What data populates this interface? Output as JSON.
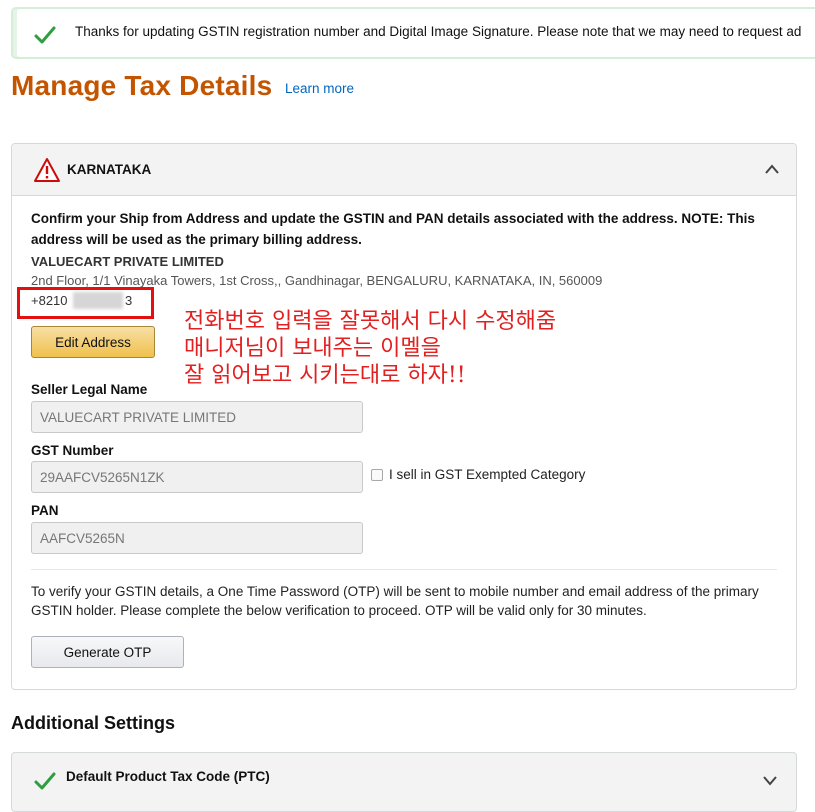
{
  "alert": {
    "message": "Thanks for updating GSTIN registration number and Digital Image Signature. Please note that we may need to request ad"
  },
  "header": {
    "title": "Manage Tax Details",
    "learn_more": "Learn more"
  },
  "state_panel": {
    "region": "KARNATAKA",
    "confirm_text": "Confirm your Ship from Address and update the GSTIN and PAN details associated with the address. NOTE: This address will be used as the primary billing address.",
    "company_name": "VALUECART PRIVATE LIMITED",
    "address": "2nd Floor, 1/1 Vinayaka Towers, 1st Cross,, Gandhinagar, BENGALURU, KARNATAKA, IN, 560009",
    "phone_prefix": "+8210",
    "phone_suffix": "3",
    "edit_address_label": "Edit Address",
    "seller_legal_name_label": "Seller Legal Name",
    "seller_legal_name_value": "VALUECART PRIVATE LIMITED",
    "gst_number_label": "GST Number",
    "gst_number_value": "29AAFCV5265N1ZK",
    "exempt_label": "I sell in GST Exempted Category",
    "pan_label": "PAN",
    "pan_value": "AAFCV5265N",
    "verify_text": "To verify your GSTIN details, a One Time Password (OTP) will be sent to mobile number and email address of the primary GSTIN holder. Please complete the below verification to proceed. OTP will be valid only for 30 minutes.",
    "generate_otp_label": "Generate OTP"
  },
  "annotation": {
    "line1": "전화번호 입력을 잘못해서 다시 수정해줌",
    "line2": "매니저님이 보내주는 이멜을",
    "line3": "잘 읽어보고 시키는대로 하자!!",
    "color": "#e32020"
  },
  "additional_settings": {
    "title": "Additional Settings",
    "ptc_label": "Default Product Tax Code (PTC)"
  },
  "icons": {
    "alert": "check-icon",
    "region": "warning-icon",
    "expand": "chevron-up-icon",
    "collapse": "chevron-down-icon"
  },
  "colors": {
    "title": "#c45500",
    "link": "#0066c0",
    "success": "#2e9e3e",
    "warning": "#cc0c0c",
    "primary_button": "#f0c14b"
  }
}
